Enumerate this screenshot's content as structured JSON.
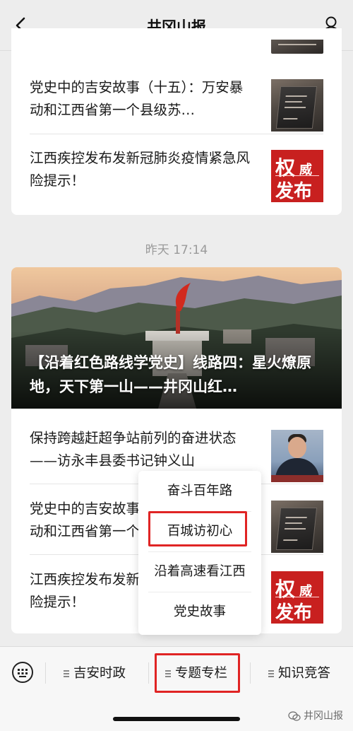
{
  "header": {
    "title": "井冈山报"
  },
  "feed_top": {
    "articles": [
      {
        "title": "党史中的吉安故事（十五）：万安暴动和江西省第一个县级苏…"
      },
      {
        "title": "江西疾控发布发新冠肺炎疫情紧急风险提示！"
      }
    ]
  },
  "timestamp": "昨天 17:14",
  "feed_main": {
    "hero": {
      "title": "【沿着红色路线学党史】线路四：星火燎原地，天下第一山——井冈山红…"
    },
    "articles": [
      {
        "title": "保持跨越赶超争站前列的奋进状态——访永丰县委书记钟义山"
      },
      {
        "title": "党史中的吉安故事（十五）：万安暴动和江西省第一个县级苏…"
      },
      {
        "title": "江西疾控发布发新冠肺炎疫情紧急风险提示！"
      }
    ]
  },
  "thumbs": {
    "auth_line1a": "权",
    "auth_line1b": "威",
    "auth_line2": "发布"
  },
  "popup_menu": {
    "items": [
      "奋斗百年路",
      "百城访初心",
      "沿着高速看江西",
      "党史故事"
    ],
    "highlighted": "百城访初心"
  },
  "bottom_menu": {
    "tabs": [
      "吉安时政",
      "专题专栏",
      "知识竞答"
    ],
    "active": "专题专栏"
  },
  "watermark": "井冈山报",
  "colors": {
    "highlight_red": "#e02424",
    "background": "#ededed",
    "auth_red": "#c8201f"
  }
}
